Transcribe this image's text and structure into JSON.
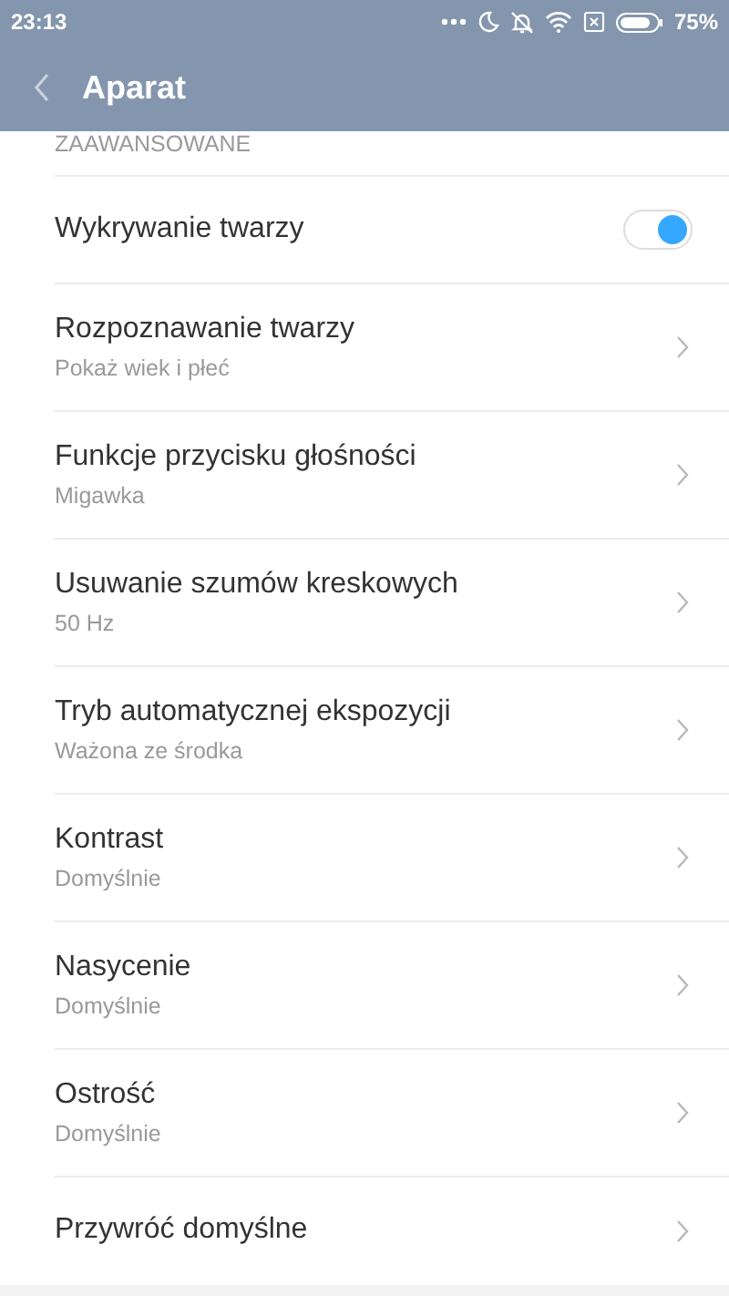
{
  "status_bar": {
    "time": "23:13",
    "battery": "75%"
  },
  "app_bar": {
    "title": "Aparat"
  },
  "section": {
    "title": "ZAAWANSOWANE"
  },
  "rows": [
    {
      "kind": "toggle",
      "title": "Wykrywanie twarzy",
      "on": true
    },
    {
      "kind": "link",
      "title": "Rozpoznawanie twarzy",
      "subtitle": "Pokaż wiek i płeć"
    },
    {
      "kind": "link",
      "title": "Funkcje przycisku głośności",
      "subtitle": "Migawka"
    },
    {
      "kind": "link",
      "title": "Usuwanie szumów kreskowych",
      "subtitle": "50 Hz"
    },
    {
      "kind": "link",
      "title": "Tryb automatycznej ekspozycji",
      "subtitle": "Ważona ze środka"
    },
    {
      "kind": "link",
      "title": "Kontrast",
      "subtitle": "Domyślnie"
    },
    {
      "kind": "link",
      "title": "Nasycenie",
      "subtitle": "Domyślnie"
    },
    {
      "kind": "link",
      "title": "Ostrość",
      "subtitle": "Domyślnie"
    },
    {
      "kind": "link",
      "title": "Przywróć domyślne"
    }
  ]
}
